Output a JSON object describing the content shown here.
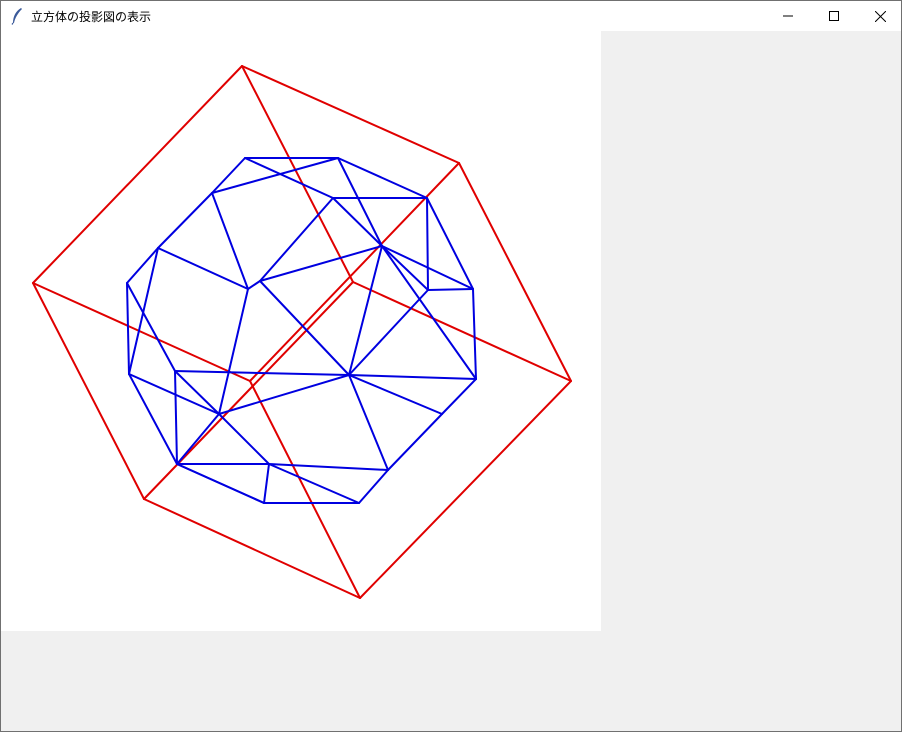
{
  "window": {
    "title": "立方体の投影図の表示",
    "controls": [
      "minimize-icon",
      "maximize-icon",
      "close-icon"
    ]
  },
  "canvas": {
    "background": "#ffffff",
    "cube_color": "#e00000",
    "solid_color": "#0000e0"
  }
}
